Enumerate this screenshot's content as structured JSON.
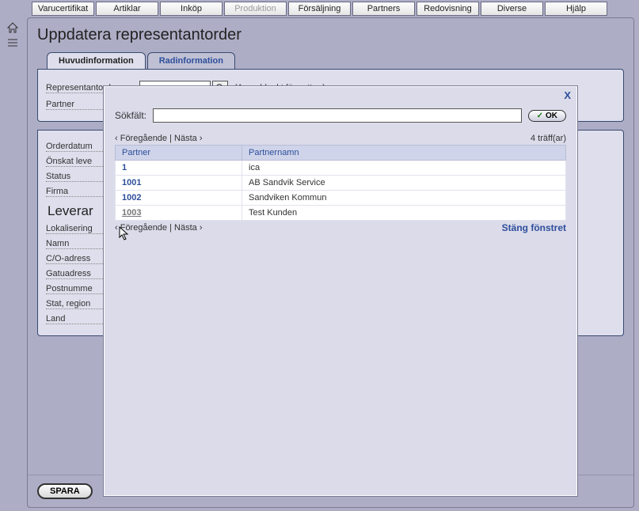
{
  "menu": {
    "items": [
      {
        "label": "Varucertifikat",
        "disabled": false
      },
      {
        "label": "Artiklar",
        "disabled": false
      },
      {
        "label": "Inköp",
        "disabled": false
      },
      {
        "label": "Produktion",
        "disabled": true
      },
      {
        "label": "Försäljning",
        "disabled": false
      },
      {
        "label": "Partners",
        "disabled": false
      },
      {
        "label": "Redovisning",
        "disabled": false
      },
      {
        "label": "Diverse",
        "disabled": false
      },
      {
        "label": "Hjälp",
        "disabled": false
      }
    ]
  },
  "page": {
    "title": "Uppdatera representantorder",
    "tabs": [
      "Huvudinformation",
      "Radinformation"
    ],
    "active_tab": 0,
    "save_label": "SPARA"
  },
  "form": {
    "order_label": "Representantorder",
    "order_hint": "(Ange blankt för nytt nr)",
    "partner_label": "Partner",
    "orderdatum_label": "Orderdatum",
    "onskat_label": "Önskat leve",
    "status_label": "Status",
    "firma_label": "Firma",
    "section2_title": "Leverar",
    "lokalisering_label": "Lokalisering",
    "namn_label": "Namn",
    "co_label": "C/O-adress",
    "gatu_label": "Gatuadress",
    "postnr_label": "Postnumme",
    "stat_label": "Stat, region",
    "land_label": "Land"
  },
  "modal": {
    "close_x": "X",
    "search_label": "Sökfält:",
    "ok_label": "OK",
    "prev_label": "‹ Föregående",
    "sep": " | ",
    "next_label": "Nästa ›",
    "hits": "4 träff(ar)",
    "col_partner": "Partner",
    "col_name": "Partnernamn",
    "rows": [
      {
        "id": "1",
        "name": "ica"
      },
      {
        "id": "1001",
        "name": "AB Sandvik Service"
      },
      {
        "id": "1002",
        "name": "Sandviken Kommun"
      },
      {
        "id": "1003",
        "name": "Test Kunden"
      }
    ],
    "selected_row": 3,
    "close_label": "Stäng fönstret"
  }
}
